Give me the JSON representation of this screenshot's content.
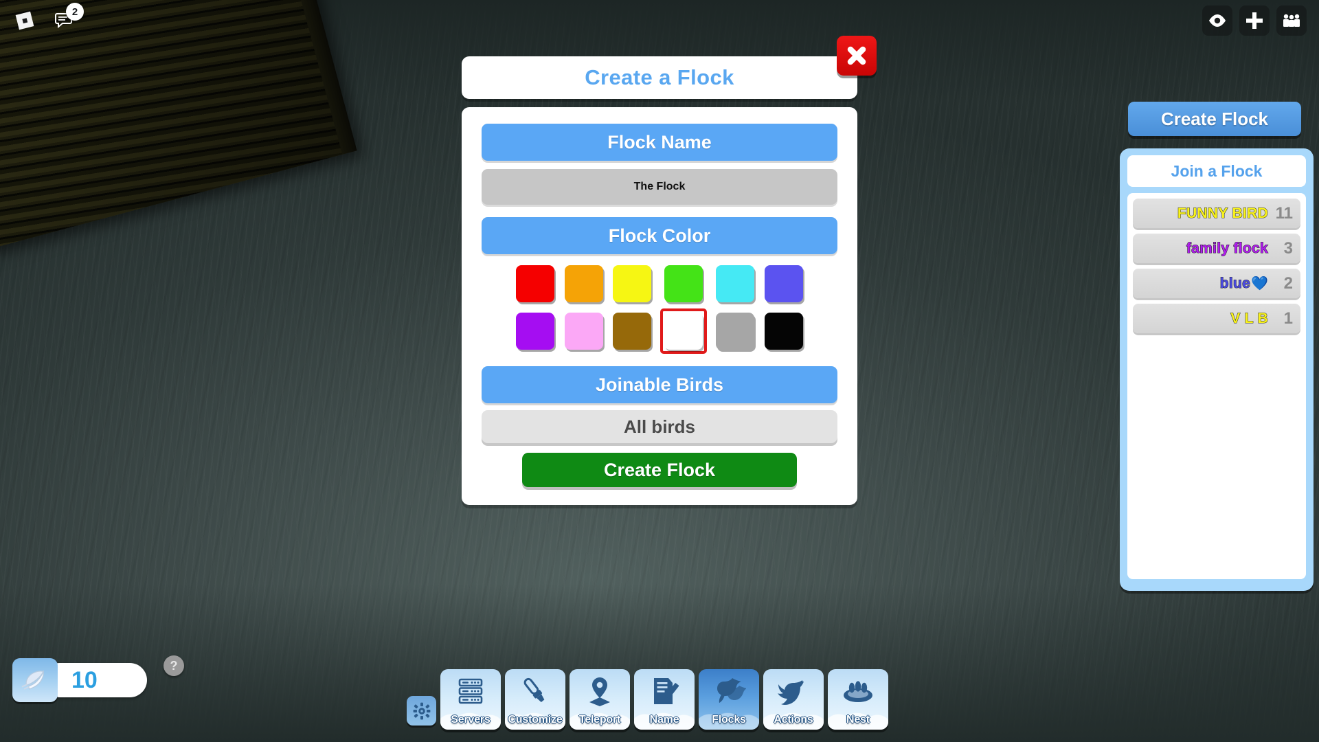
{
  "topbar": {
    "roblox_logo": "roblox-logo",
    "chat_icon": "chat-icon",
    "chat_badge": "2",
    "eye_icon": "eye-icon",
    "plus_icon": "plus-icon",
    "players_icon": "players-icon"
  },
  "dialog": {
    "title": "Create a Flock",
    "close_label": "✖",
    "flock_name_header": "Flock Name",
    "flock_name_value": "The Flock",
    "flock_name_placeholder": "The Flock",
    "flock_color_header": "Flock Color",
    "joinable_header": "Joinable Birds",
    "joinable_value": "All birds",
    "create_button": "Create Flock",
    "colors": [
      {
        "name": "red",
        "hex": "#F50000",
        "selected": false
      },
      {
        "name": "orange",
        "hex": "#F5A306",
        "selected": false
      },
      {
        "name": "yellow",
        "hex": "#F6F613",
        "selected": false
      },
      {
        "name": "green",
        "hex": "#44E317",
        "selected": false
      },
      {
        "name": "cyan",
        "hex": "#45E9F4",
        "selected": false
      },
      {
        "name": "blue-violet",
        "hex": "#5B53F0",
        "selected": false
      },
      {
        "name": "purple",
        "hex": "#A50DF2",
        "selected": false
      },
      {
        "name": "pink",
        "hex": "#FBA8F6",
        "selected": false
      },
      {
        "name": "brown",
        "hex": "#96690A",
        "selected": false
      },
      {
        "name": "white",
        "hex": "#FFFFFF",
        "selected": true
      },
      {
        "name": "gray",
        "hex": "#A6A6A6",
        "selected": false
      },
      {
        "name": "black",
        "hex": "#050505",
        "selected": false
      }
    ]
  },
  "side_panel": {
    "create_flock_button": "Create Flock",
    "join_header": "Join a Flock",
    "flocks": [
      {
        "name": "FUNNY BIRD",
        "count": "11",
        "color": "#F9F31C"
      },
      {
        "name": "family flock",
        "count": "3",
        "color": "#B01CEE"
      },
      {
        "name": "blue",
        "count": "2",
        "color": "#4B4BE0",
        "emoji": "💙"
      },
      {
        "name": "V L B",
        "count": "1",
        "color": "#F9F31C"
      }
    ]
  },
  "currency": {
    "icon": "feather-icon",
    "value": "10",
    "help_badge": "?"
  },
  "toolbar": {
    "settings_icon": "gear-icon",
    "items": [
      {
        "label": "Servers",
        "icon": "server-rack-icon",
        "active": false
      },
      {
        "label": "Customize",
        "icon": "paintbrush-icon",
        "active": false
      },
      {
        "label": "Teleport",
        "icon": "map-pin-icon",
        "active": false
      },
      {
        "label": "Name",
        "icon": "note-pencil-icon",
        "active": false
      },
      {
        "label": "Flocks",
        "icon": "birds-icon",
        "active": true
      },
      {
        "label": "Actions",
        "icon": "bird-icon",
        "active": false
      },
      {
        "label": "Nest",
        "icon": "nest-icon",
        "active": false
      }
    ]
  }
}
